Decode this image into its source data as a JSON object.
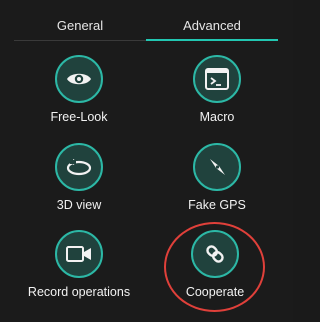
{
  "tabs": [
    {
      "label": "General",
      "active": false
    },
    {
      "label": "Advanced",
      "active": true
    }
  ],
  "tools": [
    {
      "label": "Free-Look",
      "icon": "eye-icon"
    },
    {
      "label": "Macro",
      "icon": "terminal-icon"
    },
    {
      "label": "3D view",
      "icon": "rotate-3d-icon"
    },
    {
      "label": "Fake GPS",
      "icon": "compass-icon"
    },
    {
      "label": "Record operations",
      "icon": "video-camera-icon"
    },
    {
      "label": "Cooperate",
      "icon": "link-icon"
    }
  ],
  "colors": {
    "accent": "#22c7b2",
    "circle_fill": "#20423d",
    "highlight": "#e0403a"
  }
}
